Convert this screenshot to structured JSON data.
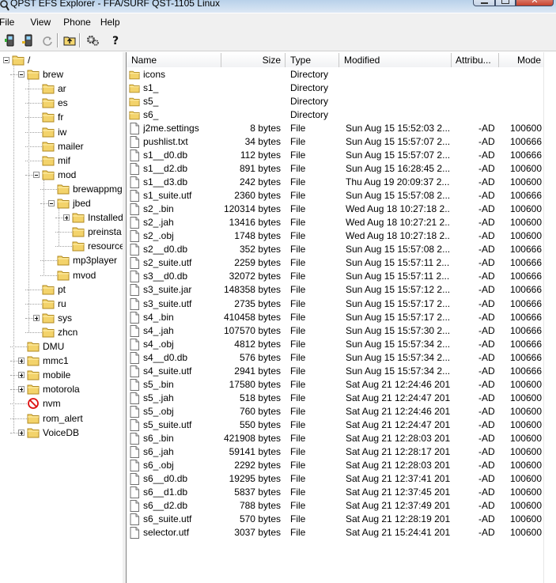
{
  "window": {
    "title": "QPST EFS Explorer - FFA/SURF QST-1105 Linux"
  },
  "menu": [
    "File",
    "View",
    "Phone",
    "Help"
  ],
  "toolbar": {
    "buttons": [
      {
        "icon": "phone-icon"
      },
      {
        "icon": "phone-connect-icon"
      },
      {
        "icon": "refresh-icon"
      },
      {
        "icon": "folder-up-icon"
      },
      {
        "icon": "settings-icon"
      },
      {
        "icon": "help-icon"
      }
    ]
  },
  "tree": {
    "nodes": [
      {
        "label": "/",
        "depth": 0,
        "expander": "minus",
        "icon": "folder-icon"
      },
      {
        "label": "brew",
        "depth": 1,
        "expander": "minus",
        "icon": "folder-icon"
      },
      {
        "label": "ar",
        "depth": 2,
        "expander": "",
        "icon": "folder-icon"
      },
      {
        "label": "es",
        "depth": 2,
        "expander": "",
        "icon": "folder-icon"
      },
      {
        "label": "fr",
        "depth": 2,
        "expander": "",
        "icon": "folder-icon"
      },
      {
        "label": "iw",
        "depth": 2,
        "expander": "",
        "icon": "folder-icon"
      },
      {
        "label": "mailer",
        "depth": 2,
        "expander": "",
        "icon": "folder-icon"
      },
      {
        "label": "mif",
        "depth": 2,
        "expander": "",
        "icon": "folder-icon"
      },
      {
        "label": "mod",
        "depth": 2,
        "expander": "minus",
        "icon": "folder-icon"
      },
      {
        "label": "brewappmg",
        "depth": 3,
        "expander": "",
        "icon": "folder-icon"
      },
      {
        "label": "jbed",
        "depth": 3,
        "expander": "minus",
        "icon": "folder-icon"
      },
      {
        "label": "Installed",
        "depth": 4,
        "expander": "plus",
        "icon": "folder-icon"
      },
      {
        "label": "preinsta",
        "depth": 4,
        "expander": "",
        "icon": "folder-icon"
      },
      {
        "label": "resource",
        "depth": 4,
        "expander": "",
        "icon": "folder-icon"
      },
      {
        "label": "mp3player",
        "depth": 3,
        "expander": "",
        "icon": "folder-icon"
      },
      {
        "label": "mvod",
        "depth": 3,
        "expander": "",
        "icon": "folder-icon"
      },
      {
        "label": "pt",
        "depth": 2,
        "expander": "",
        "icon": "folder-icon"
      },
      {
        "label": "ru",
        "depth": 2,
        "expander": "",
        "icon": "folder-icon"
      },
      {
        "label": "sys",
        "depth": 2,
        "expander": "plus",
        "icon": "folder-icon"
      },
      {
        "label": "zhcn",
        "depth": 2,
        "expander": "",
        "icon": "folder-icon"
      },
      {
        "label": "DMU",
        "depth": 1,
        "expander": "",
        "icon": "folder-icon"
      },
      {
        "label": "mmc1",
        "depth": 1,
        "expander": "plus",
        "icon": "folder-icon"
      },
      {
        "label": "mobile",
        "depth": 1,
        "expander": "plus",
        "icon": "folder-icon"
      },
      {
        "label": "motorola",
        "depth": 1,
        "expander": "plus",
        "icon": "folder-icon"
      },
      {
        "label": "nvm",
        "depth": 1,
        "expander": "",
        "icon": "no-access-icon"
      },
      {
        "label": "rom_alert",
        "depth": 1,
        "expander": "",
        "icon": "folder-icon"
      },
      {
        "label": "VoiceDB",
        "depth": 1,
        "expander": "plus",
        "icon": "folder-icon"
      }
    ]
  },
  "list": {
    "columns": [
      "Name",
      "Size",
      "Type",
      "Modified",
      "Attribu...",
      "Mode"
    ],
    "rows": [
      {
        "icon": "folder-icon",
        "name": "icons",
        "size": "",
        "type": "Directory",
        "modified": "",
        "attr": "",
        "mode": ""
      },
      {
        "icon": "folder-icon",
        "name": "s1_",
        "size": "",
        "type": "Directory",
        "modified": "",
        "attr": "",
        "mode": ""
      },
      {
        "icon": "folder-icon",
        "name": "s5_",
        "size": "",
        "type": "Directory",
        "modified": "",
        "attr": "",
        "mode": ""
      },
      {
        "icon": "folder-icon",
        "name": "s6_",
        "size": "",
        "type": "Directory",
        "modified": "",
        "attr": "",
        "mode": ""
      },
      {
        "icon": "file-icon",
        "name": "j2me.settings",
        "size": "8 bytes",
        "type": "File",
        "modified": "Sun Aug 15 15:52:03 2...",
        "attr": "-AD",
        "mode": "100600"
      },
      {
        "icon": "file-icon",
        "name": "pushlist.txt",
        "size": "34 bytes",
        "type": "File",
        "modified": "Sun Aug 15 15:57:07 2...",
        "attr": "-AD",
        "mode": "100666"
      },
      {
        "icon": "file-icon",
        "name": "s1__d0.db",
        "size": "112 bytes",
        "type": "File",
        "modified": "Sun Aug 15 15:57:07 2...",
        "attr": "-AD",
        "mode": "100666"
      },
      {
        "icon": "file-icon",
        "name": "s1__d2.db",
        "size": "891 bytes",
        "type": "File",
        "modified": "Sun Aug 15 16:28:45 2...",
        "attr": "-AD",
        "mode": "100600"
      },
      {
        "icon": "file-icon",
        "name": "s1__d3.db",
        "size": "242 bytes",
        "type": "File",
        "modified": "Thu Aug 19 20:09:37 2...",
        "attr": "-AD",
        "mode": "100600"
      },
      {
        "icon": "file-icon",
        "name": "s1_suite.utf",
        "size": "2360 bytes",
        "type": "File",
        "modified": "Sun Aug 15 15:57:08 2...",
        "attr": "-AD",
        "mode": "100666"
      },
      {
        "icon": "file-icon",
        "name": "s2_.bin",
        "size": "120314 bytes",
        "type": "File",
        "modified": "Wed Aug 18 10:27:18 2...",
        "attr": "-AD",
        "mode": "100600"
      },
      {
        "icon": "file-icon",
        "name": "s2_.jah",
        "size": "13416 bytes",
        "type": "File",
        "modified": "Wed Aug 18 10:27:21 2...",
        "attr": "-AD",
        "mode": "100600"
      },
      {
        "icon": "file-icon",
        "name": "s2_.obj",
        "size": "1748 bytes",
        "type": "File",
        "modified": "Wed Aug 18 10:27:18 2...",
        "attr": "-AD",
        "mode": "100600"
      },
      {
        "icon": "file-icon",
        "name": "s2__d0.db",
        "size": "352 bytes",
        "type": "File",
        "modified": "Sun Aug 15 15:57:08 2...",
        "attr": "-AD",
        "mode": "100666"
      },
      {
        "icon": "file-icon",
        "name": "s2_suite.utf",
        "size": "2259 bytes",
        "type": "File",
        "modified": "Sun Aug 15 15:57:11 2...",
        "attr": "-AD",
        "mode": "100666"
      },
      {
        "icon": "file-icon",
        "name": "s3__d0.db",
        "size": "32072 bytes",
        "type": "File",
        "modified": "Sun Aug 15 15:57:11 2...",
        "attr": "-AD",
        "mode": "100666"
      },
      {
        "icon": "file-icon",
        "name": "s3_suite.jar",
        "size": "148358 bytes",
        "type": "File",
        "modified": "Sun Aug 15 15:57:12 2...",
        "attr": "-AD",
        "mode": "100666"
      },
      {
        "icon": "file-icon",
        "name": "s3_suite.utf",
        "size": "2735 bytes",
        "type": "File",
        "modified": "Sun Aug 15 15:57:17 2...",
        "attr": "-AD",
        "mode": "100666"
      },
      {
        "icon": "file-icon",
        "name": "s4_.bin",
        "size": "410458 bytes",
        "type": "File",
        "modified": "Sun Aug 15 15:57:17 2...",
        "attr": "-AD",
        "mode": "100666"
      },
      {
        "icon": "file-icon",
        "name": "s4_.jah",
        "size": "107570 bytes",
        "type": "File",
        "modified": "Sun Aug 15 15:57:30 2...",
        "attr": "-AD",
        "mode": "100666"
      },
      {
        "icon": "file-icon",
        "name": "s4_.obj",
        "size": "4812 bytes",
        "type": "File",
        "modified": "Sun Aug 15 15:57:34 2...",
        "attr": "-AD",
        "mode": "100666"
      },
      {
        "icon": "file-icon",
        "name": "s4__d0.db",
        "size": "576 bytes",
        "type": "File",
        "modified": "Sun Aug 15 15:57:34 2...",
        "attr": "-AD",
        "mode": "100666"
      },
      {
        "icon": "file-icon",
        "name": "s4_suite.utf",
        "size": "2941 bytes",
        "type": "File",
        "modified": "Sun Aug 15 15:57:34 2...",
        "attr": "-AD",
        "mode": "100666"
      },
      {
        "icon": "file-icon",
        "name": "s5_.bin",
        "size": "17580 bytes",
        "type": "File",
        "modified": "Sat Aug 21 12:24:46 2010",
        "attr": "-AD",
        "mode": "100600"
      },
      {
        "icon": "file-icon",
        "name": "s5_.jah",
        "size": "518 bytes",
        "type": "File",
        "modified": "Sat Aug 21 12:24:47 2010",
        "attr": "-AD",
        "mode": "100600"
      },
      {
        "icon": "file-icon",
        "name": "s5_.obj",
        "size": "760 bytes",
        "type": "File",
        "modified": "Sat Aug 21 12:24:46 2010",
        "attr": "-AD",
        "mode": "100600"
      },
      {
        "icon": "file-icon",
        "name": "s5_suite.utf",
        "size": "550 bytes",
        "type": "File",
        "modified": "Sat Aug 21 12:24:47 2010",
        "attr": "-AD",
        "mode": "100600"
      },
      {
        "icon": "file-icon",
        "name": "s6_.bin",
        "size": "421908 bytes",
        "type": "File",
        "modified": "Sat Aug 21 12:28:03 2010",
        "attr": "-AD",
        "mode": "100600"
      },
      {
        "icon": "file-icon",
        "name": "s6_.jah",
        "size": "59141 bytes",
        "type": "File",
        "modified": "Sat Aug 21 12:28:17 2010",
        "attr": "-AD",
        "mode": "100600"
      },
      {
        "icon": "file-icon",
        "name": "s6_.obj",
        "size": "2292 bytes",
        "type": "File",
        "modified": "Sat Aug 21 12:28:03 2010",
        "attr": "-AD",
        "mode": "100600"
      },
      {
        "icon": "file-icon",
        "name": "s6__d0.db",
        "size": "19295 bytes",
        "type": "File",
        "modified": "Sat Aug 21 12:37:41 2010",
        "attr": "-AD",
        "mode": "100600"
      },
      {
        "icon": "file-icon",
        "name": "s6__d1.db",
        "size": "5837 bytes",
        "type": "File",
        "modified": "Sat Aug 21 12:37:45 2010",
        "attr": "-AD",
        "mode": "100600"
      },
      {
        "icon": "file-icon",
        "name": "s6__d2.db",
        "size": "788 bytes",
        "type": "File",
        "modified": "Sat Aug 21 12:37:49 2010",
        "attr": "-AD",
        "mode": "100600"
      },
      {
        "icon": "file-icon",
        "name": "s6_suite.utf",
        "size": "570 bytes",
        "type": "File",
        "modified": "Sat Aug 21 12:28:19 2010",
        "attr": "-AD",
        "mode": "100600"
      },
      {
        "icon": "file-icon",
        "name": "selector.utf",
        "size": "3037 bytes",
        "type": "File",
        "modified": "Sat Aug 21 15:24:41 2010",
        "attr": "-AD",
        "mode": "100600"
      }
    ]
  }
}
